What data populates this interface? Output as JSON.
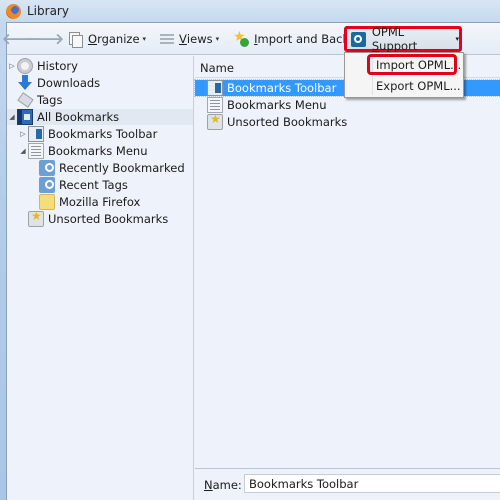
{
  "window": {
    "title": "Library"
  },
  "toolbar": {
    "back_icon": "arrow-left-icon",
    "forward_icon": "arrow-right-icon",
    "organize": {
      "label_first": "O",
      "label_rest": "rganize",
      "icon": "organize-icon"
    },
    "views": {
      "label_first": "V",
      "label_rest": "iews",
      "icon": "views-icon"
    },
    "import_backup": {
      "label_first": "I",
      "label_rest": "mport and Backup",
      "icon": "import-backup-icon"
    },
    "opml_support": {
      "label_pre": "OPML ",
      "label_first": "S",
      "label_rest": "upport",
      "icon": "opml-icon",
      "highlight_color": "#e3001b"
    },
    "dropdown_arrow": "▾"
  },
  "opml_menu": {
    "items": [
      {
        "label": "Import OPML...",
        "highlighted": true
      },
      {
        "label": "Export OPML...",
        "highlighted": false
      }
    ]
  },
  "sidebar": {
    "items": [
      {
        "label": "History",
        "icon": "history-icon",
        "twisty": "▷"
      },
      {
        "label": "Downloads",
        "icon": "downloads-icon",
        "twisty": ""
      },
      {
        "label": "Tags",
        "icon": "tags-icon",
        "twisty": ""
      },
      {
        "label": "All Bookmarks",
        "icon": "all-bookmarks-icon",
        "twisty": "◢",
        "selected": true
      },
      {
        "label": "Bookmarks Toolbar",
        "icon": "bookmarks-toolbar-icon",
        "twisty": "▷"
      },
      {
        "label": "Bookmarks Menu",
        "icon": "bookmarks-menu-icon",
        "twisty": "◢"
      },
      {
        "label": "Recently Bookmarked",
        "icon": "smart-query-icon",
        "twisty": ""
      },
      {
        "label": "Recent Tags",
        "icon": "smart-query-icon",
        "twisty": ""
      },
      {
        "label": "Mozilla Firefox",
        "icon": "folder-icon",
        "twisty": ""
      },
      {
        "label": "Unsorted Bookmarks",
        "icon": "unsorted-bookmarks-icon",
        "twisty": ""
      }
    ]
  },
  "content": {
    "column_header": "Name",
    "rows": [
      {
        "label": "Bookmarks Toolbar",
        "icon": "bookmarks-toolbar-icon",
        "selected": true
      },
      {
        "label": "Bookmarks Menu",
        "icon": "bookmarks-menu-icon",
        "selected": false
      },
      {
        "label": "Unsorted Bookmarks",
        "icon": "unsorted-bookmarks-icon",
        "selected": false
      }
    ]
  },
  "details": {
    "name_label_first": "N",
    "name_label_rest": "ame:",
    "name_value": "Bookmarks Toolbar"
  },
  "colors": {
    "selection": "#3399ff",
    "highlight_box": "#e3001b"
  }
}
